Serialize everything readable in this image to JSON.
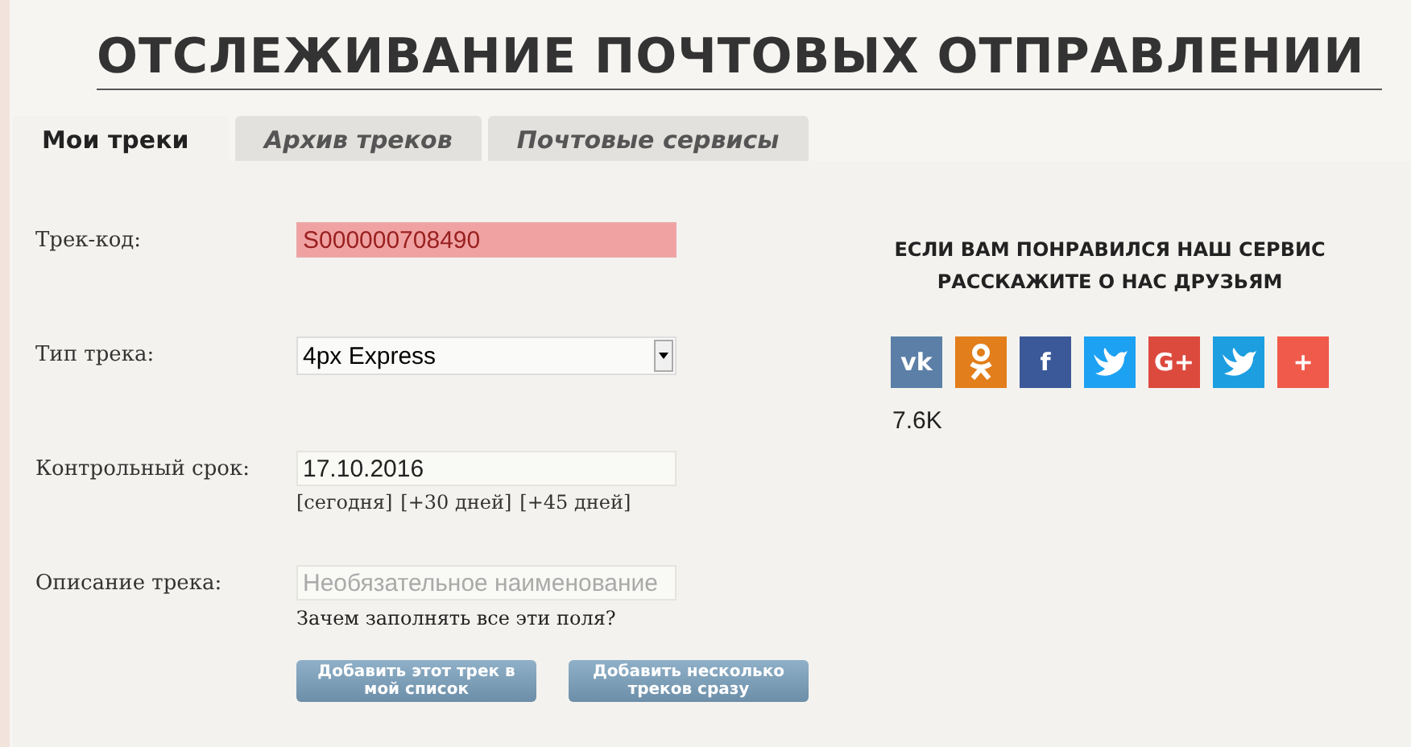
{
  "title": "ОТСЛЕЖИВАНИЕ ПОЧТОВЫХ ОТПРАВЛЕНИИ",
  "tabs": [
    {
      "label": "Мои треки",
      "selected": true
    },
    {
      "label": "Архив треков",
      "selected": false
    },
    {
      "label": "Почтовые сервисы",
      "selected": false
    }
  ],
  "form": {
    "fields": [
      {
        "kind": "input",
        "label": "Трек-код:",
        "value": "S000000708490",
        "error": true
      },
      {
        "kind": "select",
        "label": "Тип трека:",
        "value": "4px Express"
      },
      {
        "kind": "input",
        "label": "Контрольный срок:",
        "value": "17.10.2016",
        "error": false,
        "links": [
          "[сегодня]",
          "[+30 дней]",
          "[+45 дней]"
        ]
      },
      {
        "kind": "input",
        "label": "Описание трека:",
        "placeholder": "Необязательное наименование",
        "error": false,
        "hint": "Зачем заполнять все эти поля?"
      }
    ],
    "buttons": [
      "Добавить этот трек в мой список",
      "Добавить несколько треков сразу"
    ]
  },
  "share": {
    "heading": [
      "ЕСЛИ ВАМ ПОНРАВИЛСЯ НАШ СЕРВИС",
      "РАССКАЖИТЕ О НАС ДРУЗЬЯМ"
    ],
    "buttons": [
      {
        "kind": "text",
        "glyph": "vk",
        "color": "#5b7fa6"
      },
      {
        "kind": "ok",
        "color": "#e27e1b"
      },
      {
        "kind": "text",
        "glyph": "f",
        "color": "#3b5998"
      },
      {
        "kind": "bird",
        "color": "#1da1f2"
      },
      {
        "kind": "text",
        "glyph": "G+",
        "color": "#dc4a3d"
      },
      {
        "kind": "bird",
        "color": "#1c9ee0"
      },
      {
        "kind": "text",
        "glyph": "+",
        "color": "#f05a4b"
      }
    ],
    "count": "7.6K"
  }
}
